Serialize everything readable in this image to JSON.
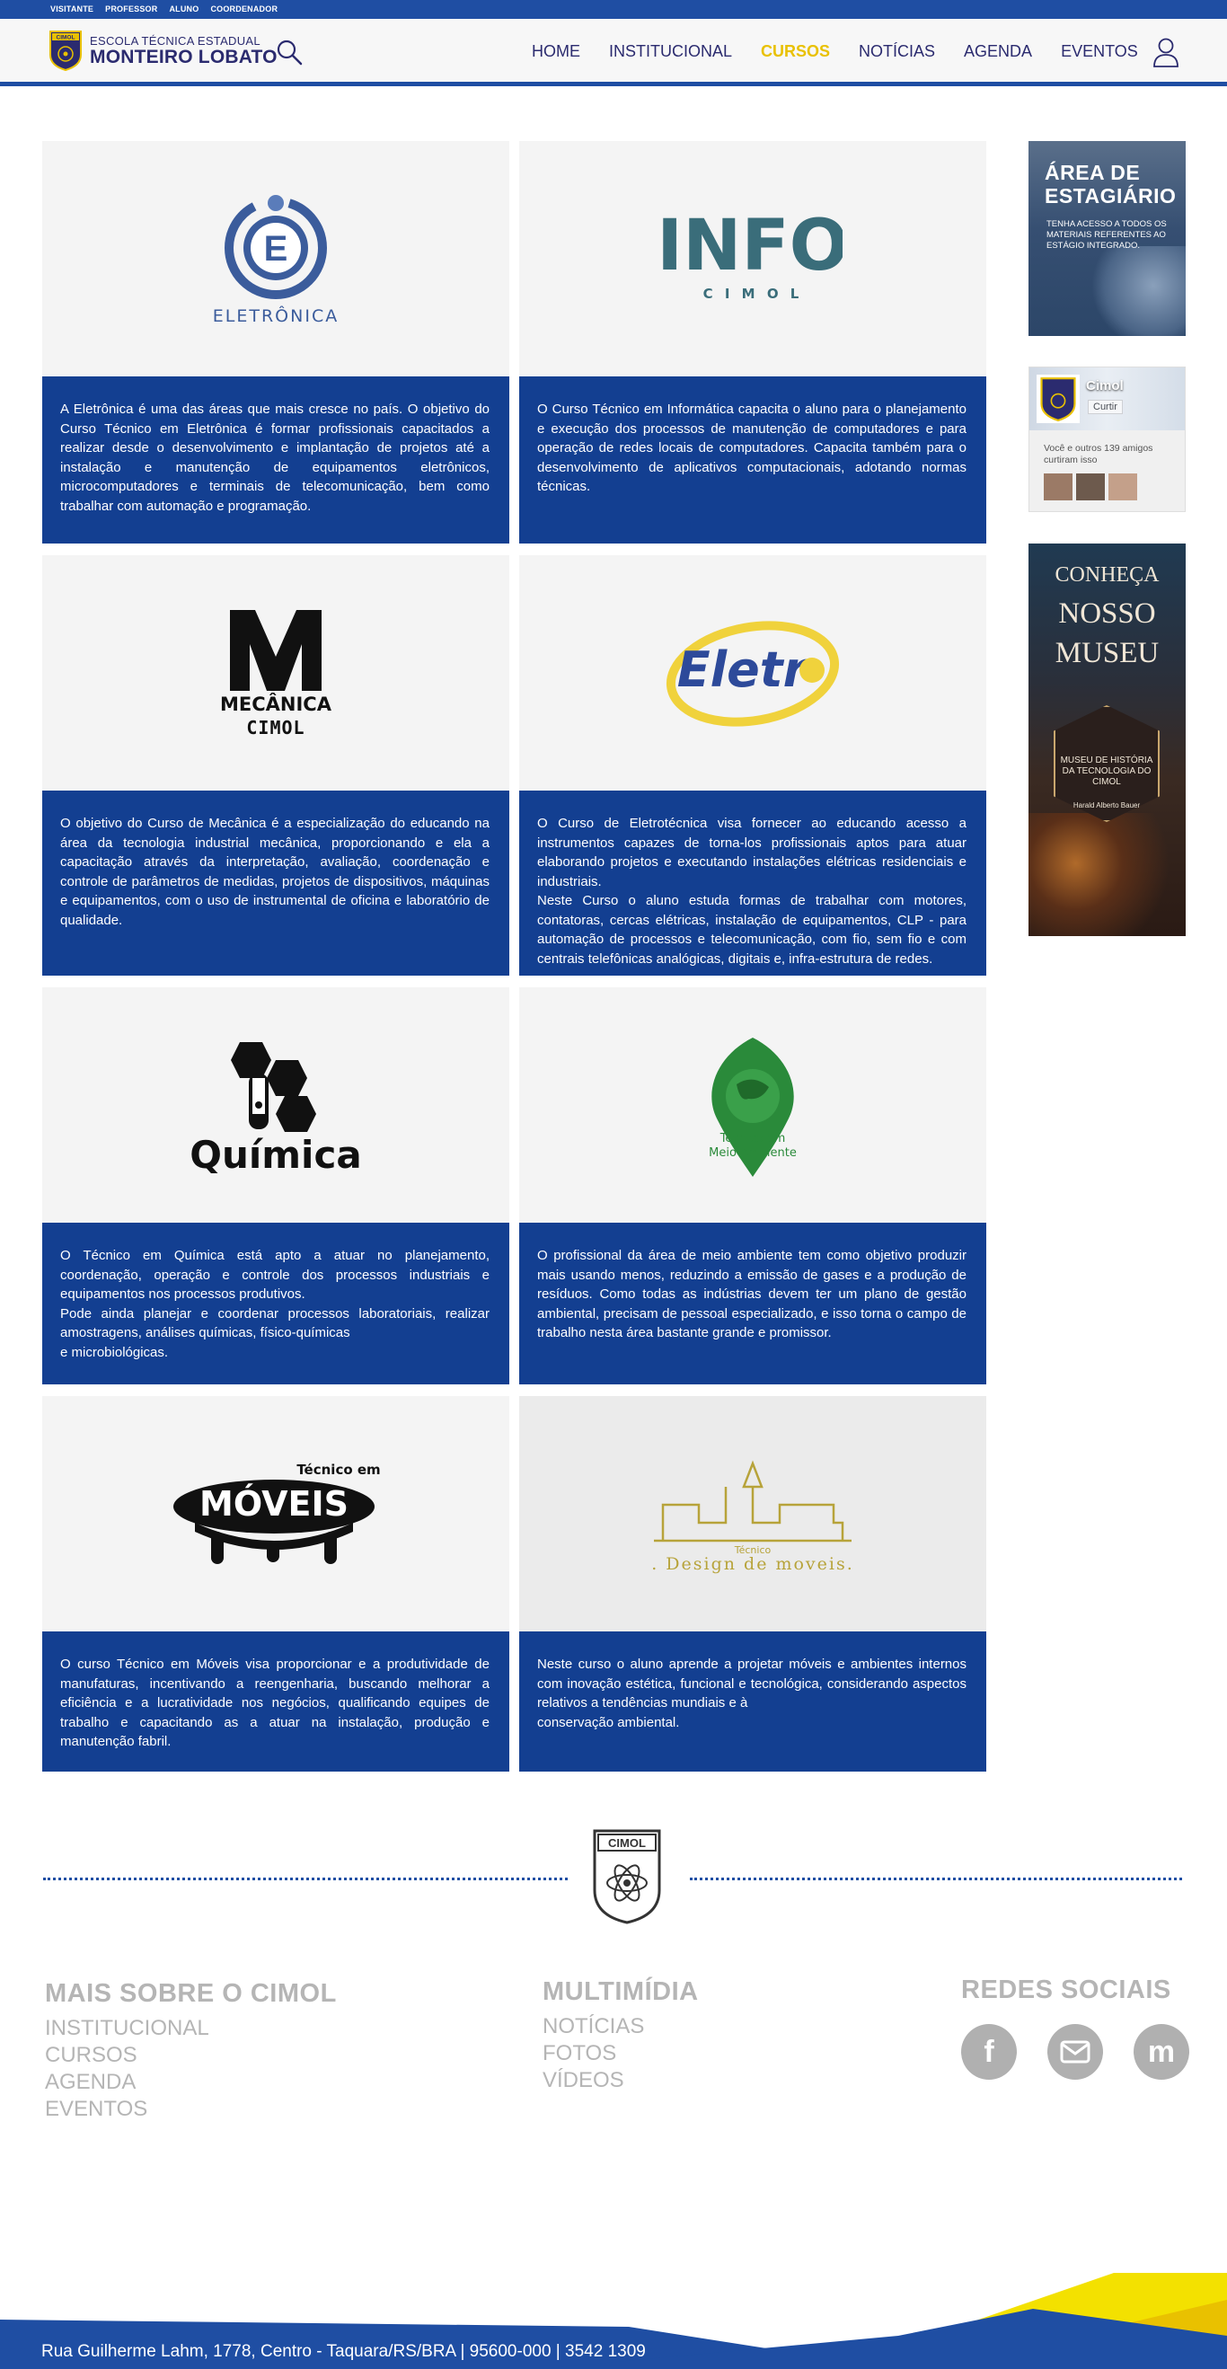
{
  "topbar": {
    "links": [
      "VISITANTE",
      "PROFESSOR",
      "ALUNO",
      "COORDENADOR"
    ]
  },
  "header": {
    "logo_line1": "ESCOLA TÉCNICA ESTADUAL",
    "logo_line2": "MONTEIRO LOBATO",
    "logo_badge": "CIMOL",
    "nav": [
      "HOME",
      "INSTITUCIONAL",
      "CURSOS",
      "NOTÍCIAS",
      "AGENDA",
      "EVENTOS"
    ],
    "active_nav": "CURSOS"
  },
  "courses": [
    {
      "logo_text": "ELETRÔNICA",
      "logo_letter": "E",
      "text": "A Eletrônica é uma das áreas que mais cresce no país. O objetivo do Curso Técnico em Eletrônica é formar profissionais capacitados a realizar desde o desenvolvimento e implantação de projetos até a instalação e manutenção de equipamentos eletrônicos, microcomputadores e terminais de telecomunicação, bem como trabalhar com automação e programação."
    },
    {
      "logo_text": "INFO",
      "logo_sub": "C I M O L",
      "text": "O Curso Técnico em Informática capacita o aluno para o planejamento e execução dos processos de manutenção de computadores e para operação de redes locais de computadores. Capacita também para o desenvolvimento de aplicativos computacionais, adotando normas técnicas."
    },
    {
      "logo_text": "MECÂNICA",
      "logo_sub": "CIMOL",
      "text": "O objetivo do Curso de Mecânica é a especialização do educando na área da tecnologia industrial mecânica, proporcionando e ela a capacitação através da interpretação, avaliação, coordenação e controle de parâmetros de medidas, projetos de dispositivos, máquinas e equipamentos, com o uso de instrumental de oficina e laboratório de qualidade."
    },
    {
      "logo_text": "Eletr",
      "text": "O Curso de Eletrotécnica visa fornecer ao educando acesso a instrumentos capazes de torna-los profissionais aptos para atuar elaborando projetos e executando instalações elétricas residenciais e industriais.\nNeste Curso o aluno estuda formas de trabalhar com motores, contatoras, cercas elétricas, instalação de equipamentos, CLP - para automação de processos e telecomunicação, com fio, sem fio e com centrais telefônicas analógicas, digitais e, infra-estrutura de redes."
    },
    {
      "logo_text": "Química",
      "text": "O Técnico em Química está apto a atuar no planejamento, coordenação, operação e controle dos processos industriais e equipamentos nos processos produtivos.\nPode ainda planejar e coordenar processos laboratoriais, realizar amostragens, análises químicas, físico-químicas\ne microbiológicas."
    },
    {
      "logo_text": "Técnico em",
      "logo_sub": "Meio Ambiente",
      "text": "O profissional da área de meio ambiente tem como objetivo produzir mais usando menos, reduzindo a emissão de gases e a produção de resíduos. Como todas as indústrias devem ter um plano de gestão ambiental, precisam de pessoal especializado, e isso torna o campo de trabalho nesta área bastante grande e promissor."
    },
    {
      "logo_text": "MÓVEIS",
      "logo_sub": "Técnico em",
      "text": "O curso Técnico em Móveis visa proporcionar e a produtividade de manufaturas, incentivando a reengenharia, buscando melhorar a eficiência e a lucratividade nos negócios, qualificando equipes de trabalho e capacitando as a atuar na instalação, produção e manutenção fabril."
    },
    {
      "logo_text": ". Design de moveis.",
      "logo_sub": "Técnico",
      "text": "Neste curso o aluno aprende a projetar móveis e ambientes internos com inovação estética, funcional e tecnológica, considerando aspectos relativos a tendências mundiais e à\nconservação ambiental."
    }
  ],
  "sidebar": {
    "estagio_title_1": "ÁREA DE",
    "estagio_title_2": "ESTAGIÁRIO",
    "estagio_text": "TENHA ACESSO A TODOS OS MATERIAIS REFERENTES AO ESTÁGIO INTEGRADO.",
    "fb_name": "Cimol",
    "fb_like": "Curtir",
    "fb_friends": "Você e outros 139 amigos curtiram isso",
    "museu_1": "CONHEÇA",
    "museu_2": "NOSSO",
    "museu_3": "MUSEU",
    "museu_hex": "MUSEU DE HISTÓRIA DA TECNOLOGIA DO CIMOL",
    "museu_sub": "Harald Alberto Bauer"
  },
  "footer": {
    "logo_badge": "CIMOL",
    "col1_title": "MAIS SOBRE O CIMOL",
    "col1_items": [
      "INSTITUCIONAL",
      "CURSOS",
      "AGENDA",
      "EVENTOS"
    ],
    "col2_title": "MULTIMÍDIA",
    "col2_items": [
      "NOTÍCIAS",
      "FOTOS",
      "VÍDEOS"
    ],
    "col3_title": "REDES SOCIAIS",
    "social_icons": [
      "facebook-icon",
      "email-icon",
      "moodle-icon"
    ],
    "address": "Rua Guilherme Lahm, 1778, Centro - Taquara/RS/BRA | 95600-000 | 3542 1309"
  },
  "colors": {
    "primary_blue": "#1f4ea3",
    "card_blue": "#133f91",
    "accent_yellow": "#e9c100",
    "footer_gray": "#b5b5b5"
  }
}
